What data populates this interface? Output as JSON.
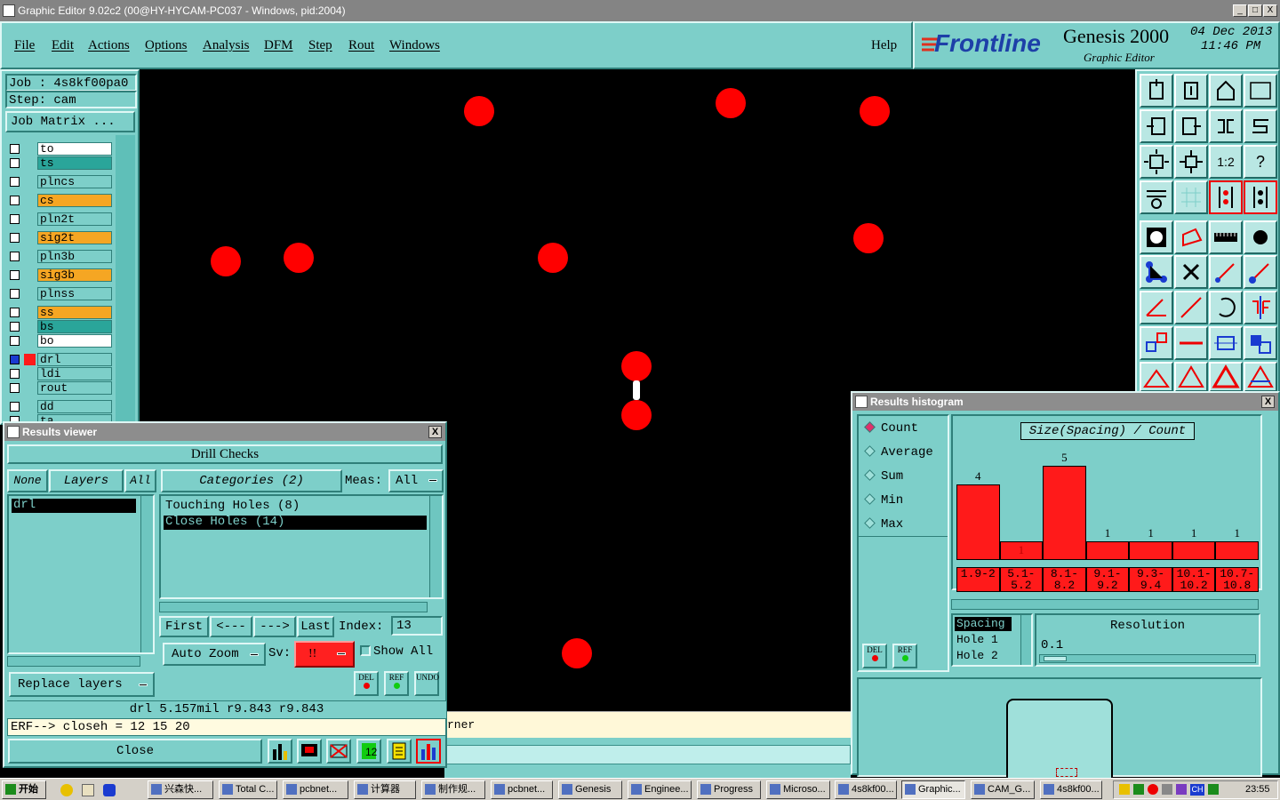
{
  "window": {
    "title": "Graphic Editor 9.02c2 (00@HY-HYCAM-PC037 - Windows, pid:2004)",
    "min": "_",
    "max": "□",
    "close": "X"
  },
  "menu": {
    "items": [
      "File",
      "Edit",
      "Actions",
      "Options",
      "Analysis",
      "DFM",
      "Step",
      "Rout",
      "Windows"
    ],
    "help": "Help"
  },
  "brand": {
    "logo": "Frontline",
    "product": "Genesis 2000",
    "subtitle": "Graphic Editor",
    "date": "04 Dec 2013",
    "time": "11:46 PM"
  },
  "job": {
    "job_line": "Job : 4s8kf00pa0",
    "step_line": "Step: cam",
    "matrix_button": "Job Matrix ..."
  },
  "layers": [
    {
      "name": "to",
      "color": "#ffffff"
    },
    {
      "name": "ts",
      "color": "#2aa59a"
    },
    {
      "name": "plncs",
      "color": "#7dcfc9"
    },
    {
      "name": "cs",
      "color": "#f5a623"
    },
    {
      "name": "pln2t",
      "color": "#7dcfc9"
    },
    {
      "name": "sig2t",
      "color": "#f5a623"
    },
    {
      "name": "pln3b",
      "color": "#7dcfc9"
    },
    {
      "name": "sig3b",
      "color": "#f5a623"
    },
    {
      "name": "plnss",
      "color": "#7dcfc9"
    },
    {
      "name": "ss",
      "color": "#f5a623"
    },
    {
      "name": "bs",
      "color": "#2aa59a"
    },
    {
      "name": "bo",
      "color": "#ffffff"
    },
    {
      "name": "drl",
      "color": "#7dcfc9"
    },
    {
      "name": "ldi",
      "color": "#7dcfc9"
    },
    {
      "name": "rout",
      "color": "#7dcfc9"
    },
    {
      "name": "dd",
      "color": "#7dcfc9"
    },
    {
      "name": "ta",
      "color": "#7dcfc9"
    }
  ],
  "results_viewer": {
    "title": "Results viewer",
    "header": "Drill Checks",
    "tabs": {
      "none": "None",
      "layers": "Layers",
      "all": "All",
      "categories": "Categories (2)",
      "meas_label": "Meas:",
      "meas_value": "All"
    },
    "layer_list": [
      "drl"
    ],
    "categories": [
      "Touching Holes (8)",
      "Close Holes (14)"
    ],
    "nav": {
      "first": "First",
      "prev": "<---",
      "next": "--->",
      "last": "Last",
      "index_label": "Index:",
      "index_value": "13"
    },
    "auto_zoom": "Auto Zoom",
    "sv_label": "Sv:",
    "sv_value": "!!",
    "show_all": "Show All",
    "replace_layers": "Replace layers",
    "del": "DEL",
    "ref": "REF",
    "undo": "UNDO",
    "status": "drl  5.157mil   r9.843   r9.843",
    "erf": "ERF--> closeh = 12 15 20",
    "close": "Close"
  },
  "canvas_fragment": "rner",
  "histogram": {
    "title": "Results histogram",
    "modes": [
      "Count",
      "Average",
      "Sum",
      "Min",
      "Max"
    ],
    "selected_mode": "Count",
    "del": "DEL",
    "ref": "REF",
    "fields": [
      "Spacing",
      "Hole 1",
      "Hole 2"
    ],
    "resolution_label": "Resolution",
    "resolution_value": "0.1"
  },
  "chart_data": {
    "type": "bar",
    "title": "Size(Spacing) / Count",
    "categories": [
      "1.9-2",
      "5.1-5.2",
      "8.1-8.2",
      "9.1-9.2",
      "9.3-9.4",
      "10.1-10.2",
      "10.7-10.8"
    ],
    "values": [
      4,
      1,
      5,
      1,
      1,
      1,
      1
    ],
    "xlabel": "",
    "ylabel": "",
    "ylim": [
      0,
      5
    ],
    "grid": false
  },
  "taskbar": {
    "start": "开始",
    "tasks": [
      "兴森快...",
      "Total C...",
      "pcbnet...",
      "计算器",
      "制作规...",
      "pcbnet...",
      "Genesis",
      "Enginee...",
      "Progress",
      "Microso...",
      "4s8kf00...",
      "Graphic...",
      "CAM_G...",
      "4s8kf00..."
    ],
    "clock": "23:55"
  }
}
